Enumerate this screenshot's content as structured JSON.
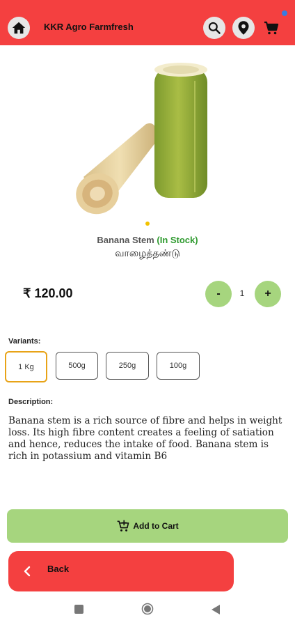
{
  "header": {
    "title": "KKR Agro Farmfresh",
    "icons": [
      "home-icon",
      "search-icon",
      "location-pin-icon",
      "cart-icon"
    ],
    "colors": {
      "bar": "#f44040",
      "notification_dot": "#3a7be0"
    }
  },
  "product": {
    "name": "Banana Stem",
    "stock_status": "(In Stock)",
    "tamil_name": "வாழைத்தண்டு",
    "price": "₹ 120.00",
    "quantity": "1",
    "minus_label": "-",
    "plus_label": "+"
  },
  "variants": {
    "label": "Variants:",
    "options": [
      "1 Kg",
      "500g",
      "250g",
      "100g"
    ],
    "selected": "1 Kg"
  },
  "description": {
    "label": "Description:",
    "text": "Banana stem is a rich source of fibre and helps in weight loss. Its high fibre content creates a feeling of satiation and hence, reduces the intake of food. Banana stem is rich in potassium and vitamin B6"
  },
  "actions": {
    "add_to_cart": "Add to Cart",
    "back": "Back"
  },
  "theme": {
    "accent_green": "#a6d57e",
    "accent_red": "#f44040",
    "selected_border": "#e8a317",
    "stock_green": "#2e9a2e"
  }
}
